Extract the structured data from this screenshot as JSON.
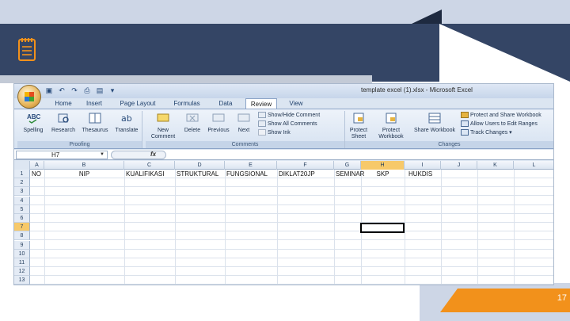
{
  "slide": {
    "page_number": "17",
    "accent_color": "#f2911b",
    "band_color": "#344565",
    "icon": "notepad-icon"
  },
  "excel": {
    "window_title": "template excel (1).xlsx - Microsoft Excel",
    "tabs": [
      "Home",
      "Insert",
      "Page Layout",
      "Formulas",
      "Data",
      "Review",
      "View"
    ],
    "active_tab": "Review",
    "ribbon": {
      "proofing": {
        "label": "Proofing",
        "buttons": [
          "Spelling",
          "Research",
          "Thesaurus",
          "Translate"
        ]
      },
      "comments": {
        "label": "Comments",
        "buttons": [
          "New Comment",
          "Delete",
          "Previous",
          "Next"
        ],
        "small": [
          "Show/Hide Comment",
          "Show All Comments",
          "Show Ink"
        ]
      },
      "changes": {
        "label": "Changes",
        "buttons": [
          "Protect Sheet",
          "Protect Workbook",
          "Share Workbook"
        ],
        "small": [
          "Protect and Share Workbook",
          "Allow Users to Edit Ranges",
          "Track Changes"
        ]
      }
    },
    "name_box": "H7",
    "fx_label": "fx",
    "columns": [
      "A",
      "B",
      "C",
      "D",
      "E",
      "F",
      "G",
      "H",
      "I",
      "J",
      "K",
      "L"
    ],
    "selected_column": "H",
    "rows": [
      "1",
      "2",
      "3",
      "4",
      "5",
      "6",
      "7",
      "8",
      "9",
      "10",
      "11",
      "12",
      "13"
    ],
    "selected_row": "7",
    "header_row": [
      "NO",
      "NIP",
      "KUALIFIKASI",
      "STRUKTURAL",
      "FUNGSIONAL",
      "DIKLAT20JP",
      "SEMINAR",
      "SKP",
      "HUKDIS",
      "",
      "",
      ""
    ]
  }
}
